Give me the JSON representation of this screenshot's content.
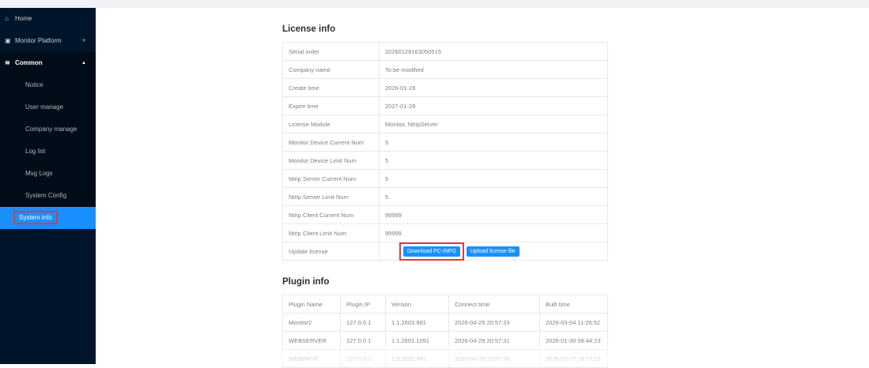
{
  "sidebar": {
    "items": [
      {
        "label": "Home",
        "icon": "home-icon"
      },
      {
        "label": "Monitor Platform",
        "icon": "monitor-icon"
      },
      {
        "label": "Common",
        "icon": "stack-icon"
      }
    ],
    "sub_items": [
      {
        "label": "Notice"
      },
      {
        "label": "User manage"
      },
      {
        "label": "Company manage"
      },
      {
        "label": "Log list"
      },
      {
        "label": "Msg Logs"
      },
      {
        "label": "System Config"
      },
      {
        "label": "System info"
      }
    ]
  },
  "license": {
    "title": "License info",
    "rows": [
      {
        "key": "Serial order",
        "value": "20260128163050515"
      },
      {
        "key": "Company name",
        "value": "To be modified"
      },
      {
        "key": "Create time",
        "value": "2026-01-28"
      },
      {
        "key": "Expire time",
        "value": "2027-01-28"
      },
      {
        "key": "License Module",
        "value": "Monitor,  NtripServer"
      },
      {
        "key": "Monitor Device Current Num",
        "value": "5"
      },
      {
        "key": "Monitor Device Limit Num",
        "value": "5"
      },
      {
        "key": "Ntrip Server Current Num",
        "value": "5"
      },
      {
        "key": "Ntrip Server Limit Num",
        "value": "5"
      },
      {
        "key": "Ntrip Client Current Num",
        "value": "99999"
      },
      {
        "key": "Ntrip Client Limit Num",
        "value": "99999"
      }
    ],
    "update_label": "Update license",
    "download_button": "Download PC-INFO",
    "upload_button": "Upload license file"
  },
  "plugin": {
    "title": "Plugin info",
    "columns": [
      "Plugin Name",
      "Plugin IP",
      "Version",
      "Connect time",
      "Built time"
    ],
    "rows": [
      [
        "Monitor2",
        "127.0.0.1",
        "1.1.2603.981",
        "2026-04-29 20:57:33",
        "2026-03-04 11:26:52"
      ],
      [
        "WEBSERVER",
        "127.0.0.1",
        "1.1.2601.1091",
        "2026-04-29 20:57:31",
        "2026-01-30 08:44:23"
      ],
      [
        "WEBPAGE",
        "127.0.0.1",
        "1.0.2603.941",
        "2026-04-29 20:57:31",
        "2026-02-27 18:17:23"
      ]
    ]
  },
  "colors": {
    "sidebar_bg": "#001529",
    "accent": "#1890ff",
    "highlight": "#e5393b"
  }
}
